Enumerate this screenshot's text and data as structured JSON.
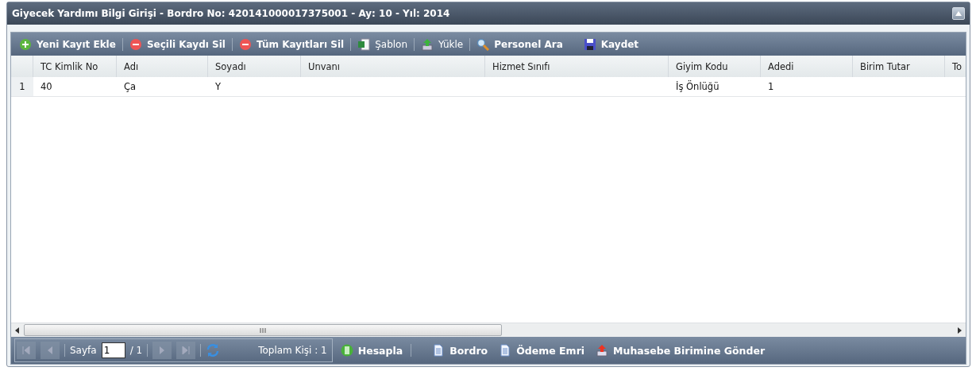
{
  "window": {
    "title": "Giyecek Yardımı Bilgi Girişi - Bordro No: 420141000017375001 - Ay: 10 - Yıl: 2014"
  },
  "toolbar": [
    {
      "label": "Yeni Kayıt Ekle",
      "bold": true
    },
    {
      "label": "Seçili Kaydı Sil",
      "bold": true
    },
    {
      "label": "Tüm Kayıtları Sil",
      "bold": true
    },
    {
      "label": "Şablon",
      "bold": false
    },
    {
      "label": "Yükle",
      "bold": false
    },
    {
      "label": "Personel Ara",
      "bold": true
    },
    {
      "label": "Kaydet",
      "bold": true
    }
  ],
  "table": {
    "columns": [
      "TC Kimlik No",
      "Adı",
      "Soyadı",
      "Unvanı",
      "Hizmet Sınıfı",
      "Giyim Kodu",
      "Adedi",
      "Birim Tutar",
      "To"
    ],
    "rows": [
      {
        "number": "1",
        "cells": [
          "40",
          "Ça",
          "Y",
          "",
          "",
          "İş Önlüğü",
          "1",
          "",
          ""
        ]
      }
    ]
  },
  "pager": {
    "first_disabled": true,
    "prev_disabled": true,
    "next_disabled": true,
    "last_disabled": true,
    "page_label": "Sayfa",
    "page": "1",
    "of": "/ 1",
    "total": "Toplam Kişi : 1"
  },
  "actions": [
    "Hesapla",
    "Bordro",
    "Ödeme Emri",
    "Muhasebe Birimine Gönder"
  ]
}
